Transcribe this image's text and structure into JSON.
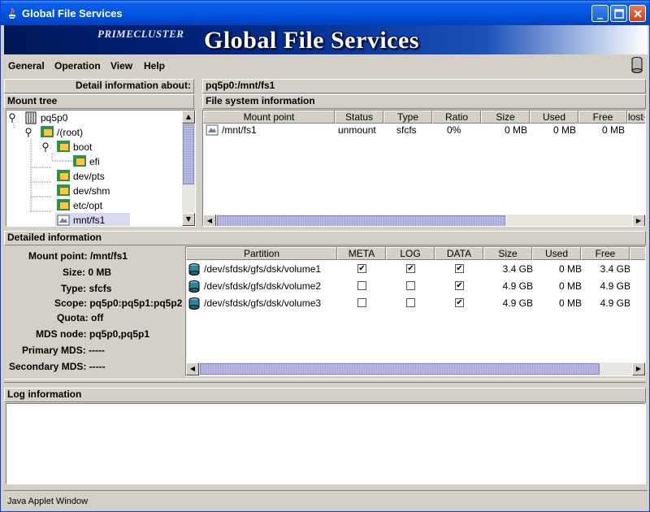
{
  "window": {
    "title": "Global File Services"
  },
  "banner": {
    "brand": "PRIMECLUSTER",
    "title": "Global File Services"
  },
  "menu": [
    "General",
    "Operation",
    "View",
    "Help"
  ],
  "detail_header": {
    "label": "Detail information about:",
    "value": "pq5p0:/mnt/fs1"
  },
  "mount_tree": {
    "header": "Mount tree",
    "items": [
      {
        "label": "pq5p0",
        "icon": "server-icon"
      },
      {
        "label": "/(root)",
        "icon": "folder-icon"
      },
      {
        "label": "boot",
        "icon": "folder-icon"
      },
      {
        "label": "efi",
        "icon": "folder-icon"
      },
      {
        "label": "dev/pts",
        "icon": "folder-icon"
      },
      {
        "label": "dev/shm",
        "icon": "folder-icon"
      },
      {
        "label": "etc/opt",
        "icon": "folder-icon"
      },
      {
        "label": "mnt/fs1",
        "icon": "filesystem-icon",
        "selected": true
      }
    ]
  },
  "fs_info": {
    "header": "File system information",
    "columns": [
      "Mount point",
      "Status",
      "Type",
      "Ratio",
      "Size",
      "Used",
      "Free",
      "lost+"
    ],
    "rows": [
      {
        "mount_point": "/mnt/fs1",
        "status": "unmount",
        "type": "sfcfs",
        "ratio": "0%",
        "size": "0 MB",
        "used": "0 MB",
        "free": "0 MB"
      }
    ]
  },
  "detailed": {
    "header": "Detailed information",
    "labels": {
      "mount_point": "Mount point: /mnt/fs1",
      "size": "Size: 0 MB",
      "type": "Type: sfcfs",
      "scope": "Scope: pq5p0:pq5p1:pq5p2",
      "quota": "Quota: off",
      "mds_node": "MDS node: pq5p0,pq5p1",
      "primary_mds": "Primary MDS: -----",
      "secondary_mds": "Secondary MDS: -----"
    },
    "partition_columns": [
      "Partition",
      "META",
      "LOG",
      "DATA",
      "Size",
      "Used",
      "Free"
    ],
    "partitions": [
      {
        "name": "/dev/sfdsk/gfs/dsk/volume1",
        "meta": true,
        "log": true,
        "data": true,
        "size": "3.4 GB",
        "used": "0 MB",
        "free": "3.4 GB"
      },
      {
        "name": "/dev/sfdsk/gfs/dsk/volume2",
        "meta": false,
        "log": false,
        "data": true,
        "size": "4.9 GB",
        "used": "0 MB",
        "free": "4.9 GB"
      },
      {
        "name": "/dev/sfdsk/gfs/dsk/volume3",
        "meta": false,
        "log": false,
        "data": true,
        "size": "4.9 GB",
        "used": "0 MB",
        "free": "4.9 GB"
      }
    ]
  },
  "log": {
    "header": "Log information"
  },
  "status_bar": {
    "text": "Java Applet Window"
  },
  "colors": {
    "titlebar": "#0055e5",
    "panel": "#d4d0c8",
    "selection": "#d8d8f0"
  }
}
